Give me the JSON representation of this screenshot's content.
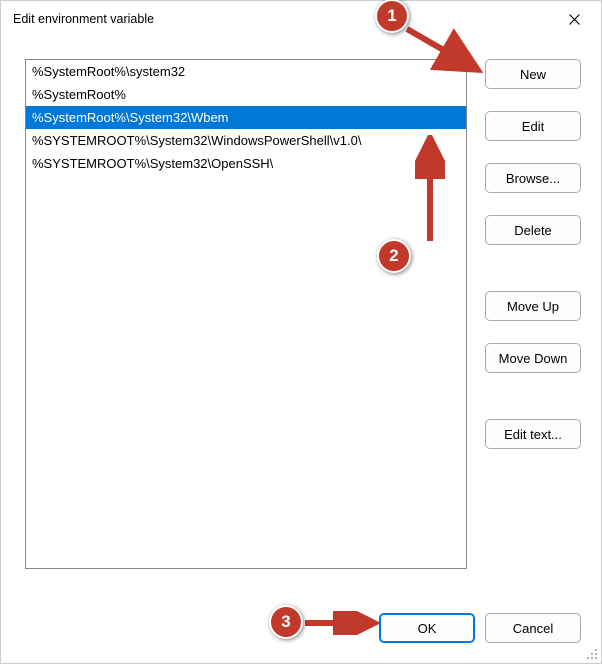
{
  "title": "Edit environment variable",
  "list": {
    "items": [
      "%SystemRoot%\\system32",
      "%SystemRoot%",
      "%SystemRoot%\\System32\\Wbem",
      "%SYSTEMROOT%\\System32\\WindowsPowerShell\\v1.0\\",
      "%SYSTEMROOT%\\System32\\OpenSSH\\"
    ],
    "selected_index": 2
  },
  "buttons": {
    "new": "New",
    "edit": "Edit",
    "browse": "Browse...",
    "delete": "Delete",
    "move_up": "Move Up",
    "move_down": "Move Down",
    "edit_text": "Edit text...",
    "ok": "OK",
    "cancel": "Cancel"
  },
  "annotations": {
    "c1": "1",
    "c2": "2",
    "c3": "3"
  }
}
